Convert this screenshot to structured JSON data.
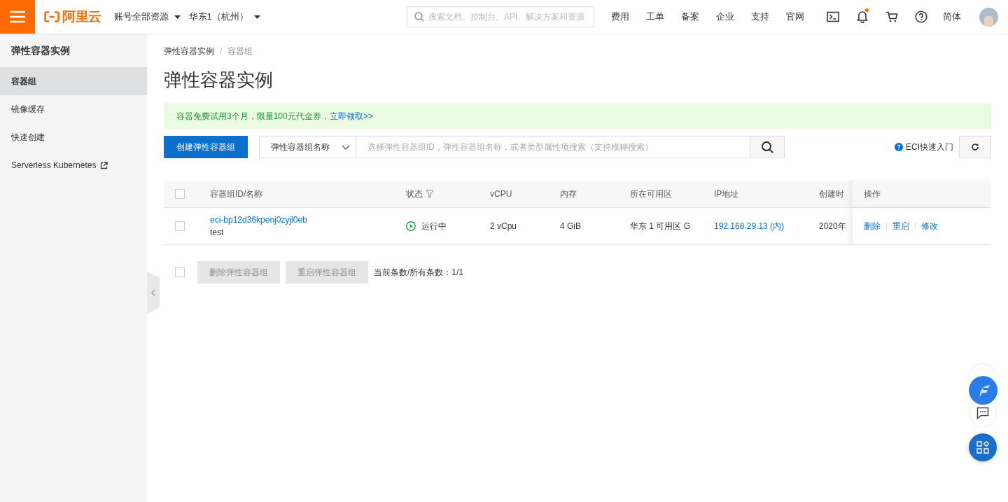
{
  "topbar": {
    "brand": "阿里云",
    "account_menu": "账号全部资源",
    "region_menu": "华东1（杭州）",
    "search": {
      "placeholder": "搜索文档、控制台、API、解决方案和资源"
    },
    "nav": [
      {
        "label": "费用"
      },
      {
        "label": "工单"
      },
      {
        "label": "备案"
      },
      {
        "label": "企业"
      },
      {
        "label": "支持"
      },
      {
        "label": "官网"
      }
    ],
    "icons": [
      {
        "kind": "terminal",
        "badge": false
      },
      {
        "kind": "bell",
        "badge": true
      },
      {
        "kind": "cart",
        "badge": false
      },
      {
        "kind": "help",
        "badge": false
      }
    ],
    "language": "简体"
  },
  "sidebar": {
    "title": "弹性容器实例",
    "items": [
      {
        "label": "容器组",
        "selected": true,
        "external": false
      },
      {
        "label": "镜像缓存",
        "selected": false,
        "external": false
      },
      {
        "label": "快速创建",
        "selected": false,
        "external": false
      },
      {
        "label": "Serverless Kubernetes",
        "selected": false,
        "external": true
      }
    ]
  },
  "breadcrumb": [
    "弹性容器实例",
    "/",
    "容器组"
  ],
  "page_title": "弹性容器实例",
  "promo": {
    "text": "容器免费试用3个月，限量100元代金券，",
    "link": "立即领取>>"
  },
  "toolbar": {
    "create_button": "创建弹性容器组",
    "filter_select": "弹性容器组名称",
    "search": {
      "placeholder": "选择弹性容器组ID，弹性容器组名称，或者类型属性项搜索（支持模糊搜索）"
    },
    "guide_link": "ECI快速入门"
  },
  "table": {
    "columns": [
      "容器组ID/名称",
      "状态",
      "vCPU",
      "内存",
      "所在可用区",
      "IP地址",
      "创建时",
      "操作"
    ],
    "header_checked": false,
    "rows": [
      {
        "checked": false,
        "id": "eci-bp12d36kpenj0zyjl0eb",
        "name": "test",
        "status": "运行中",
        "vcpu": "2 vCpu",
        "memory": "4 GiB",
        "zone": "华东 1 可用区 G",
        "ip": "192.168.29.13 (内)",
        "created": "2020年",
        "actions": [
          "删除",
          "重启",
          "修改"
        ]
      }
    ]
  },
  "footer": {
    "select_all_checked": false,
    "buttons": [
      {
        "label": "删除弹性容器组",
        "disabled": true
      },
      {
        "label": "重启弹性容器组",
        "disabled": true
      }
    ],
    "count": "当前条数/所有条数：1/1"
  }
}
